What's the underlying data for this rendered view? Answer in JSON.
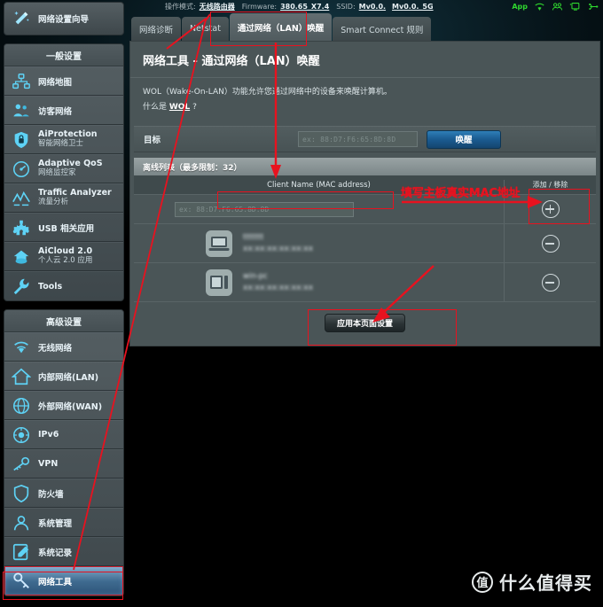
{
  "topbar": {
    "mode_label": "操作模式:",
    "mode_value": "无线路由器",
    "firmware_label": "Firmware:",
    "firmware_value": "380.65_X7.4",
    "ssid_label": "SSID:",
    "ssid_value_1": "Mv0.0.",
    "ssid_value_2": "Mv0.0._5G",
    "app_label": "App",
    "icons": [
      "wifi-icon",
      "clients-icon",
      "monitor-icon",
      "usb-icon"
    ],
    "accent_green": "#2fd82f"
  },
  "sidebar": {
    "wizard": {
      "label": "网络设置向导",
      "icon": "magic-wand-icon"
    },
    "general": {
      "title": "一般设置",
      "items": [
        {
          "label": "网络地图",
          "sub": "",
          "icon": "network-map-icon"
        },
        {
          "label": "访客网络",
          "sub": "",
          "icon": "guest-network-icon"
        },
        {
          "label": "AiProtection",
          "sub": "智能网络卫士",
          "icon": "shield-lock-icon"
        },
        {
          "label": "Adaptive QoS",
          "sub": "网络监控家",
          "icon": "gauge-icon"
        },
        {
          "label": "Traffic Analyzer",
          "sub": "流量分析",
          "icon": "traffic-chart-icon"
        },
        {
          "label": "USB 相关应用",
          "sub": "",
          "icon": "usb-apps-icon"
        },
        {
          "label": "AiCloud 2.0",
          "sub": "个人云 2.0 应用",
          "icon": "cloud-icon"
        },
        {
          "label": "Tools",
          "sub": "",
          "icon": "wrench-icon"
        }
      ]
    },
    "advanced": {
      "title": "高级设置",
      "items": [
        {
          "label": "无线网络",
          "icon": "wifi-icon",
          "selected": false
        },
        {
          "label": "内部网络(LAN)",
          "icon": "home-icon",
          "selected": false
        },
        {
          "label": "外部网络(WAN)",
          "icon": "globe-icon",
          "selected": false
        },
        {
          "label": "IPv6",
          "icon": "ipv6-icon",
          "selected": false
        },
        {
          "label": "VPN",
          "icon": "vpn-key-icon",
          "selected": false
        },
        {
          "label": "防火墙",
          "icon": "firewall-shield-icon",
          "selected": false
        },
        {
          "label": "系统管理",
          "icon": "user-admin-icon",
          "selected": false
        },
        {
          "label": "系统记录",
          "icon": "log-edit-icon",
          "selected": false
        },
        {
          "label": "网络工具",
          "icon": "network-tools-icon",
          "selected": true
        }
      ]
    }
  },
  "tabs": [
    {
      "label": "网络诊断",
      "active": false
    },
    {
      "label": "Netstat",
      "active": false
    },
    {
      "label": "通过网络（LAN）唤醒",
      "active": true
    },
    {
      "label": "Smart Connect 规则",
      "active": false
    }
  ],
  "page": {
    "title": "网络工具 - 通过网络（LAN）唤醒",
    "desc_line1": "WOL（Wake-On-LAN）功能允许您通过网络中的设备来唤醒计算机。",
    "desc_line2_pre": "什么是 ",
    "desc_link": "WOL",
    "desc_line2_post": " ?"
  },
  "target": {
    "label": "目标",
    "input_placeholder": "ex: 88:D7:F6:65:8D:8D",
    "input_value": "",
    "wake_button": "唤醒"
  },
  "list": {
    "header": "离线列表（最多限制：32）",
    "col_name": "Client Name (MAC address)",
    "col_action": "添加 / 移除",
    "rows": [
      {
        "type": "input",
        "placeholder": "ex: 88:D7:F6:65:8D:8D",
        "value": "",
        "action": "add",
        "action_icon": "plus-circle-icon"
      },
      {
        "type": "device",
        "icon": "laptop-icon",
        "name": "",
        "mac": "",
        "action": "remove",
        "action_icon": "minus-circle-icon"
      },
      {
        "type": "device",
        "icon": "desktop-icon",
        "name": "",
        "mac": "",
        "action": "remove",
        "action_icon": "minus-circle-icon"
      }
    ]
  },
  "apply": {
    "label": "应用本页面设置"
  },
  "annotations": [
    {
      "text": "填写主板真实MAC地址",
      "color": "#e8121f"
    }
  ],
  "watermark": {
    "logo": "值",
    "text": "什么值得买"
  }
}
